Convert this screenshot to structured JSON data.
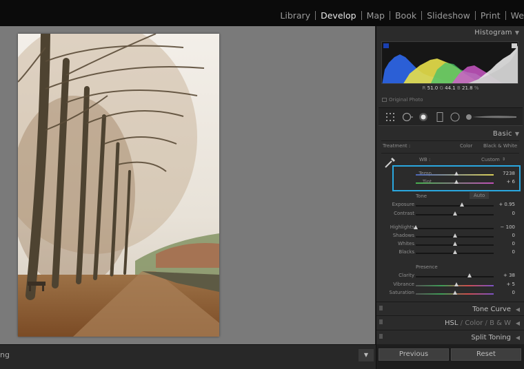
{
  "top_nav": {
    "modules": [
      "Library",
      "Develop",
      "Map",
      "Book",
      "Slideshow",
      "Print",
      "We"
    ],
    "active": "Develop"
  },
  "photo": {
    "description_icon": "photo-tree-avenue"
  },
  "bottom_toolbar": {
    "text": "ng",
    "dropdown_icon": "triangle-down-icon"
  },
  "histogram": {
    "title": "Histogram",
    "readout": {
      "r_label": "R",
      "r_value": "51.0",
      "g_label": "G",
      "g_value": "44.1",
      "b_label": "B",
      "b_value": "21.8",
      "unit": "%"
    },
    "original_photo": "Original Photo"
  },
  "basic": {
    "title": "Basic",
    "treatment_label": "Treatment :",
    "color_btn": "Color",
    "bw_btn": "Black & White",
    "wb_label": "WB :",
    "wb_value": "Custom",
    "tone_label": "Tone",
    "auto_btn": "Auto",
    "presence_label": "Presence",
    "sliders": {
      "temp": {
        "name": "Temp",
        "value": "7238",
        "pos": 0.52
      },
      "tint": {
        "name": "Tint",
        "value": "+ 6",
        "pos": 0.52
      },
      "exposure": {
        "name": "Exposure",
        "value": "+ 0.95",
        "pos": 0.59
      },
      "contrast": {
        "name": "Contrast",
        "value": "0",
        "pos": 0.5
      },
      "highlights": {
        "name": "Highlights",
        "value": "− 100",
        "pos": 0.0
      },
      "shadows": {
        "name": "Shadows",
        "value": "0",
        "pos": 0.5
      },
      "whites": {
        "name": "Whites",
        "value": "0",
        "pos": 0.5
      },
      "blacks": {
        "name": "Blacks",
        "value": "0",
        "pos": 0.5
      },
      "clarity": {
        "name": "Clarity",
        "value": "+ 38",
        "pos": 0.69
      },
      "vibrance": {
        "name": "Vibrance",
        "value": "+ 5",
        "pos": 0.52
      },
      "saturation": {
        "name": "Saturation",
        "value": "0",
        "pos": 0.5
      }
    }
  },
  "panels": {
    "tone_curve": "Tone Curve",
    "hsl": "HSL",
    "hsl_color": "Color",
    "hsl_bw": "B & W",
    "split_toning": "Split Toning"
  },
  "buttons": {
    "previous": "Previous",
    "reset": "Reset"
  },
  "colors": {
    "highlight_box": "#2aa8e0",
    "panel_bg": "#2b2b2b",
    "canvas_bg": "#7a7a7a"
  }
}
